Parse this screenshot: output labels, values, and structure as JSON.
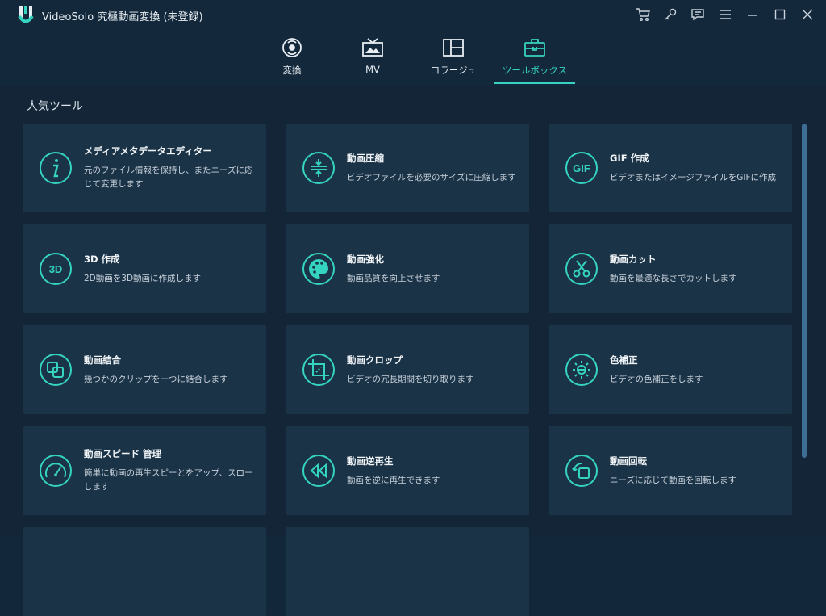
{
  "app": {
    "title": "VideoSolo 究極動画変換 (未登録)"
  },
  "window_controls": [
    {
      "name": "cart-icon"
    },
    {
      "name": "key-icon"
    },
    {
      "name": "feedback-icon"
    },
    {
      "name": "menu-icon"
    },
    {
      "name": "minimize-icon"
    },
    {
      "name": "maximize-icon"
    },
    {
      "name": "close-icon"
    }
  ],
  "tabs": [
    {
      "label": "変換",
      "icon": "convert-icon",
      "active": false
    },
    {
      "label": "MV",
      "icon": "mv-icon",
      "active": false
    },
    {
      "label": "コラージュ",
      "icon": "collage-icon",
      "active": false
    },
    {
      "label": "ツールボックス",
      "icon": "toolbox-icon",
      "active": true
    }
  ],
  "section": {
    "title": "人気ツール"
  },
  "tools": [
    {
      "name": "メディアメタデータエディター",
      "desc": "元のファイル情報を保持し、またニーズに応じて変更します",
      "icon": "info-icon"
    },
    {
      "name": "動画圧縮",
      "desc": "ビデオファイルを必要のサイズに圧縮します",
      "icon": "compress-icon"
    },
    {
      "name": "GIF 作成",
      "desc": "ビデオまたはイメージファイルをGIFに作成",
      "icon": "gif-icon"
    },
    {
      "name": "3D 作成",
      "desc": "2D動画を3D動画に作成します",
      "icon": "3d-icon"
    },
    {
      "name": "動画強化",
      "desc": "動画品質を向上させます",
      "icon": "palette-icon"
    },
    {
      "name": "動画カット",
      "desc": "動画を最適な長さでカットします",
      "icon": "scissors-icon"
    },
    {
      "name": "動画結合",
      "desc": "幾つかのクリップを一つに結合します",
      "icon": "merge-icon"
    },
    {
      "name": "動画クロップ",
      "desc": "ビデオの冗長期間を切り取ります",
      "icon": "crop-icon"
    },
    {
      "name": "色補正",
      "desc": "ビデオの色補正をします",
      "icon": "color-correct-icon"
    },
    {
      "name": "動画スピード 管理",
      "desc": "簡単に動画の再生スピーとをアップ、スローします",
      "icon": "speedometer-icon"
    },
    {
      "name": "動画逆再生",
      "desc": "動画を逆に再生できます",
      "icon": "rewind-icon"
    },
    {
      "name": "動画回転",
      "desc": "ニーズに応じて動画を回転します",
      "icon": "rotate-icon"
    }
  ],
  "colors": {
    "accent": "#35d4c0",
    "background": "#132536",
    "card": "#1b3347",
    "header": "#14283b"
  }
}
